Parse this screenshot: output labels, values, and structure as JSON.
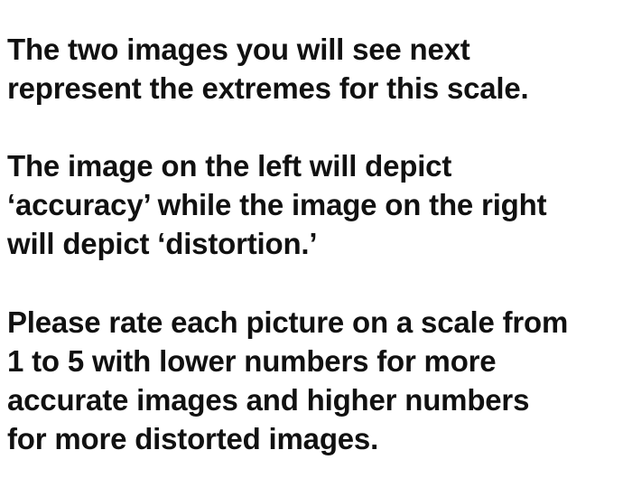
{
  "paragraphs": [
    {
      "lines": [
        "The two images you will see next",
        "represent the extremes for this scale."
      ]
    },
    {
      "lines": [
        "The image on the left will depict",
        "‘accuracy’ while the image on the right",
        "will depict ‘distortion.’"
      ]
    },
    {
      "lines": [
        "Please rate each picture on a scale from",
        "1 to 5 with lower numbers for more",
        "accurate images and higher numbers",
        "for more distorted images."
      ]
    }
  ],
  "colors": {
    "background": "#ffffff",
    "text": "#111111"
  }
}
